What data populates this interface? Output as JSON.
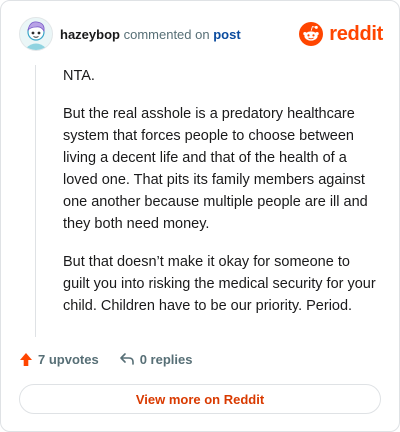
{
  "header": {
    "username": "hazeybop",
    "action_text": "commented on",
    "post_link": "post",
    "brand": "reddit"
  },
  "comment": {
    "paragraphs": [
      "NTA.",
      "But the real asshole is a predatory healthcare system that forces people to choose between living a decent life and that of the health of a loved one. That pits its family members against one another because multiple people are ill and they both need money.",
      "But that doesn’t make it okay for someone to guilt you into risking the medical security for your child. Children have to be our priority. Period."
    ]
  },
  "actions": {
    "upvotes": "7 upvotes",
    "replies": "0 replies"
  },
  "footer": {
    "view_more": "View more on Reddit"
  },
  "colors": {
    "brand": "#ff4500",
    "link": "#0a4b9e",
    "cta": "#d93a00",
    "muted": "#576f76"
  },
  "icons": {
    "avatar": "snoo-avatar",
    "logo": "reddit-logo-icon",
    "upvote": "upvote-arrow-icon",
    "reply": "reply-arrow-icon"
  }
}
